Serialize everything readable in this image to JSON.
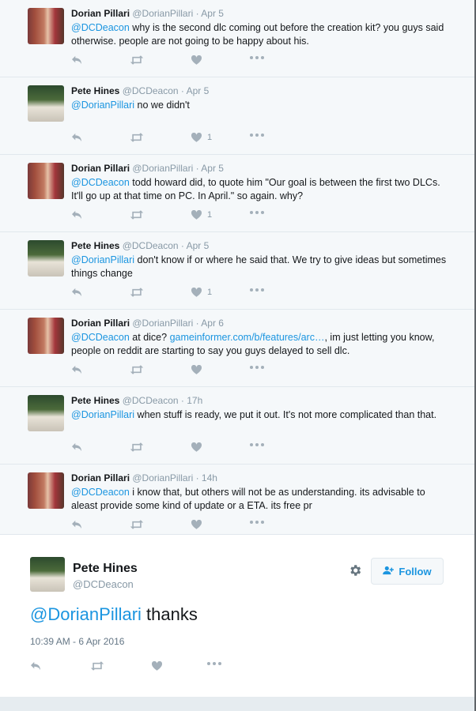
{
  "thread": [
    {
      "name": "Dorian Pillari",
      "handle": "@DorianPillari",
      "date": "Apr 5",
      "avatar": "dorian",
      "segments": [
        {
          "t": "@DCDeacon",
          "k": "mention"
        },
        {
          "t": " why is the second dlc coming out before the creation kit? you guys said otherwise. people are not going to be happy about his.",
          "k": "text"
        }
      ],
      "likes": ""
    },
    {
      "name": "Pete Hines",
      "handle": "@DCDeacon",
      "date": "Apr 5",
      "avatar": "pete",
      "segments": [
        {
          "t": "@DorianPillari",
          "k": "mention"
        },
        {
          "t": " no we didn't",
          "k": "text"
        }
      ],
      "likes": "1"
    },
    {
      "name": "Dorian Pillari",
      "handle": "@DorianPillari",
      "date": "Apr 5",
      "avatar": "dorian",
      "segments": [
        {
          "t": "@DCDeacon",
          "k": "mention"
        },
        {
          "t": " todd howard did, to quote him \"Our goal is between the first two DLCs. It'll go up at that time on PC. In April.\" so again. why?",
          "k": "text"
        }
      ],
      "likes": "1"
    },
    {
      "name": "Pete Hines",
      "handle": "@DCDeacon",
      "date": "Apr 5",
      "avatar": "pete",
      "segments": [
        {
          "t": "@DorianPillari",
          "k": "mention"
        },
        {
          "t": " don't know if or where he said that. We try to give ideas but sometimes things change",
          "k": "text"
        }
      ],
      "likes": "1"
    },
    {
      "name": "Dorian Pillari",
      "handle": "@DorianPillari",
      "date": "Apr 6",
      "avatar": "dorian",
      "segments": [
        {
          "t": "@DCDeacon",
          "k": "mention"
        },
        {
          "t": " at dice? ",
          "k": "text"
        },
        {
          "t": "gameinformer.com/b/features/arc…",
          "k": "link"
        },
        {
          "t": ", im just letting you know, people on reddit are starting to say you guys delayed to sell dlc.",
          "k": "text"
        }
      ],
      "likes": ""
    },
    {
      "name": "Pete Hines",
      "handle": "@DCDeacon",
      "date": "17h",
      "avatar": "pete",
      "segments": [
        {
          "t": "@DorianPillari",
          "k": "mention"
        },
        {
          "t": " when stuff is ready, we put it out. It's not more complicated than that.",
          "k": "text"
        }
      ],
      "likes": ""
    },
    {
      "name": "Dorian Pillari",
      "handle": "@DorianPillari",
      "date": "14h",
      "avatar": "dorian",
      "segments": [
        {
          "t": "@DCDeacon",
          "k": "mention"
        },
        {
          "t": " i know that, but others will  not be as understanding. its advisable to aleast provide some kind of update or a ETA. its free pr",
          "k": "text"
        }
      ],
      "likes": ""
    }
  ],
  "detail": {
    "name": "Pete Hines",
    "handle": "@DCDeacon",
    "mention": "@DorianPillari",
    "text": " thanks",
    "timestamp": "10:39 AM - 6 Apr 2016",
    "follow_label": "Follow"
  },
  "icons": {
    "reply": "reply-icon",
    "retweet": "retweet-icon",
    "like": "heart-icon",
    "more": "more-icon",
    "settings": "gear-icon",
    "follow": "follow-user-icon"
  },
  "colors": {
    "link": "#1b95e0",
    "muted": "#8899a6",
    "icon": "#a4b0ba",
    "background": "#f5f8fa"
  }
}
